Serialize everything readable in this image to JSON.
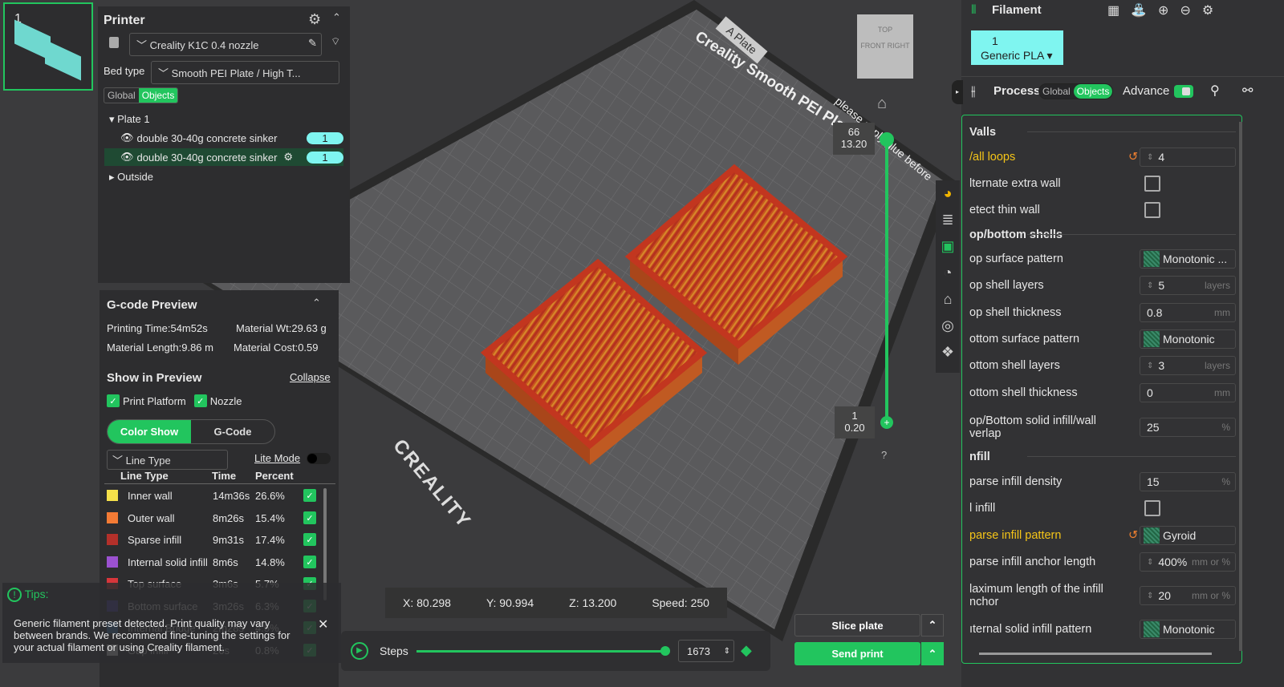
{
  "plate_thumb": {
    "number": "1"
  },
  "printer": {
    "title": "Printer",
    "printer_name": "Creality K1C 0.4 nozzle",
    "bed_type_label": "Bed type",
    "bed_type": "Smooth PEI Plate / High T...",
    "seg": [
      "Global",
      "Objects"
    ],
    "tree": {
      "plate": "Plate 1",
      "objects": [
        {
          "name": "double 30-40g concrete sinker",
          "count": "1"
        },
        {
          "name": "double 30-40g concrete sinker",
          "count": "1"
        }
      ],
      "outside": "Outside"
    }
  },
  "gcode": {
    "title": "G-code Preview",
    "printing_time": "Printing Time:54m52s",
    "material_wt": "Material Wt:29.63 g",
    "material_length": "Material Length:9.86 m",
    "material_cost": "Material Cost:0.59",
    "show_title": "Show in Preview",
    "collapse": "Collapse",
    "print_platform": "Print Platform",
    "nozzle": "Nozzle",
    "tab_color": "Color Show",
    "tab_gcode": "G-Code",
    "view_select": "Line Type",
    "lite_mode": "Lite Mode",
    "headers": [
      "Line Type",
      "Time",
      "Percent"
    ],
    "rows": [
      {
        "name": "Inner wall",
        "time": "14m36s",
        "pct": "26.6%",
        "color": "#f5e04a"
      },
      {
        "name": "Outer wall",
        "time": "8m26s",
        "pct": "15.4%",
        "color": "#f47b35"
      },
      {
        "name": "Sparse infill",
        "time": "9m31s",
        "pct": "17.4%",
        "color": "#b3302a"
      },
      {
        "name": "Internal solid infill",
        "time": "8m6s",
        "pct": "14.8%",
        "color": "#9b51d0"
      },
      {
        "name": "Top surface",
        "time": "3m6s",
        "pct": "5.7%",
        "color": "#d8363b"
      },
      {
        "name": "Bottom surface",
        "time": "3m26s",
        "pct": "6.3%",
        "color": "#4b3fa8"
      },
      {
        "name": "Internal Bridge",
        "time": "2m28s",
        "pct": "4.5%",
        "color": "#3f7fc4"
      },
      {
        "name": "Gap infill",
        "time": "26s",
        "pct": "0.8%",
        "color": "#e0e0e0"
      }
    ]
  },
  "tips": {
    "title": "Tips:",
    "text": "Generic filament preset detected. Print quality may vary between brands. We recommend fine-tuning the settings for your actual filament or using Creality filament."
  },
  "viewport": {
    "plate_label": "A Plate",
    "bed_text": "Creality Smooth PEI Plate",
    "glue_text": "please apply glue before",
    "brand": "CREALITY",
    "cube": [
      "TOP",
      "FRONT",
      "RIGHT"
    ],
    "layer_top": "66",
    "layer_top_h": "13.20",
    "layer_bot": "1",
    "layer_bot_h": "0.20",
    "help": "?"
  },
  "status": {
    "x": "X: 80.298",
    "y": "Y: 90.994",
    "z": "Z: 13.200",
    "speed": "Speed: 250"
  },
  "steps": {
    "label": "Steps",
    "value": "1673",
    "progress": 0.98
  },
  "actions": {
    "slice": "Slice plate",
    "send": "Send print"
  },
  "filament": {
    "title": "Filament",
    "slot": "1",
    "name": "Generic PLA",
    "color": "#7ff5f0"
  },
  "process": {
    "title": "Process",
    "seg": [
      "Global",
      "Objects"
    ],
    "advance": "Advance",
    "rows": [
      {
        "t": "sec",
        "label": "Valls"
      },
      {
        "t": "num",
        "label": "/all loops",
        "val": "4",
        "mod": true,
        "spin": true
      },
      {
        "t": "cb",
        "label": "lternate extra wall"
      },
      {
        "t": "cb",
        "label": "etect thin wall"
      },
      {
        "t": "sec",
        "label": "op/bottom shells"
      },
      {
        "t": "pat",
        "label": "op surface pattern",
        "val": "Monotonic ..."
      },
      {
        "t": "num",
        "label": "op shell layers",
        "val": "5",
        "unit": "layers",
        "spin": true
      },
      {
        "t": "num",
        "label": "op shell thickness",
        "val": "0.8",
        "unit": "mm"
      },
      {
        "t": "pat",
        "label": "ottom surface pattern",
        "val": "Monotonic"
      },
      {
        "t": "num",
        "label": "ottom shell layers",
        "val": "3",
        "unit": "layers",
        "spin": true
      },
      {
        "t": "num",
        "label": "ottom shell thickness",
        "val": "0",
        "unit": "mm"
      },
      {
        "t": "num",
        "label": "op/Bottom solid infill/wall verlap",
        "val": "25",
        "unit": "%"
      },
      {
        "t": "sec",
        "label": "nfill"
      },
      {
        "t": "num",
        "label": "parse infill density",
        "val": "15",
        "unit": "%"
      },
      {
        "t": "cb",
        "label": "l infill"
      },
      {
        "t": "pat",
        "label": "parse infill pattern",
        "val": "Gyroid",
        "mod": true
      },
      {
        "t": "num",
        "label": "parse infill anchor length",
        "val": "400%",
        "unit": "mm or %",
        "spin": true
      },
      {
        "t": "num",
        "label": "laximum length of the infill nchor",
        "val": "20",
        "unit": "mm or %",
        "spin": true
      },
      {
        "t": "pat",
        "label": "ıternal solid infill pattern",
        "val": "Monotonic"
      }
    ]
  }
}
